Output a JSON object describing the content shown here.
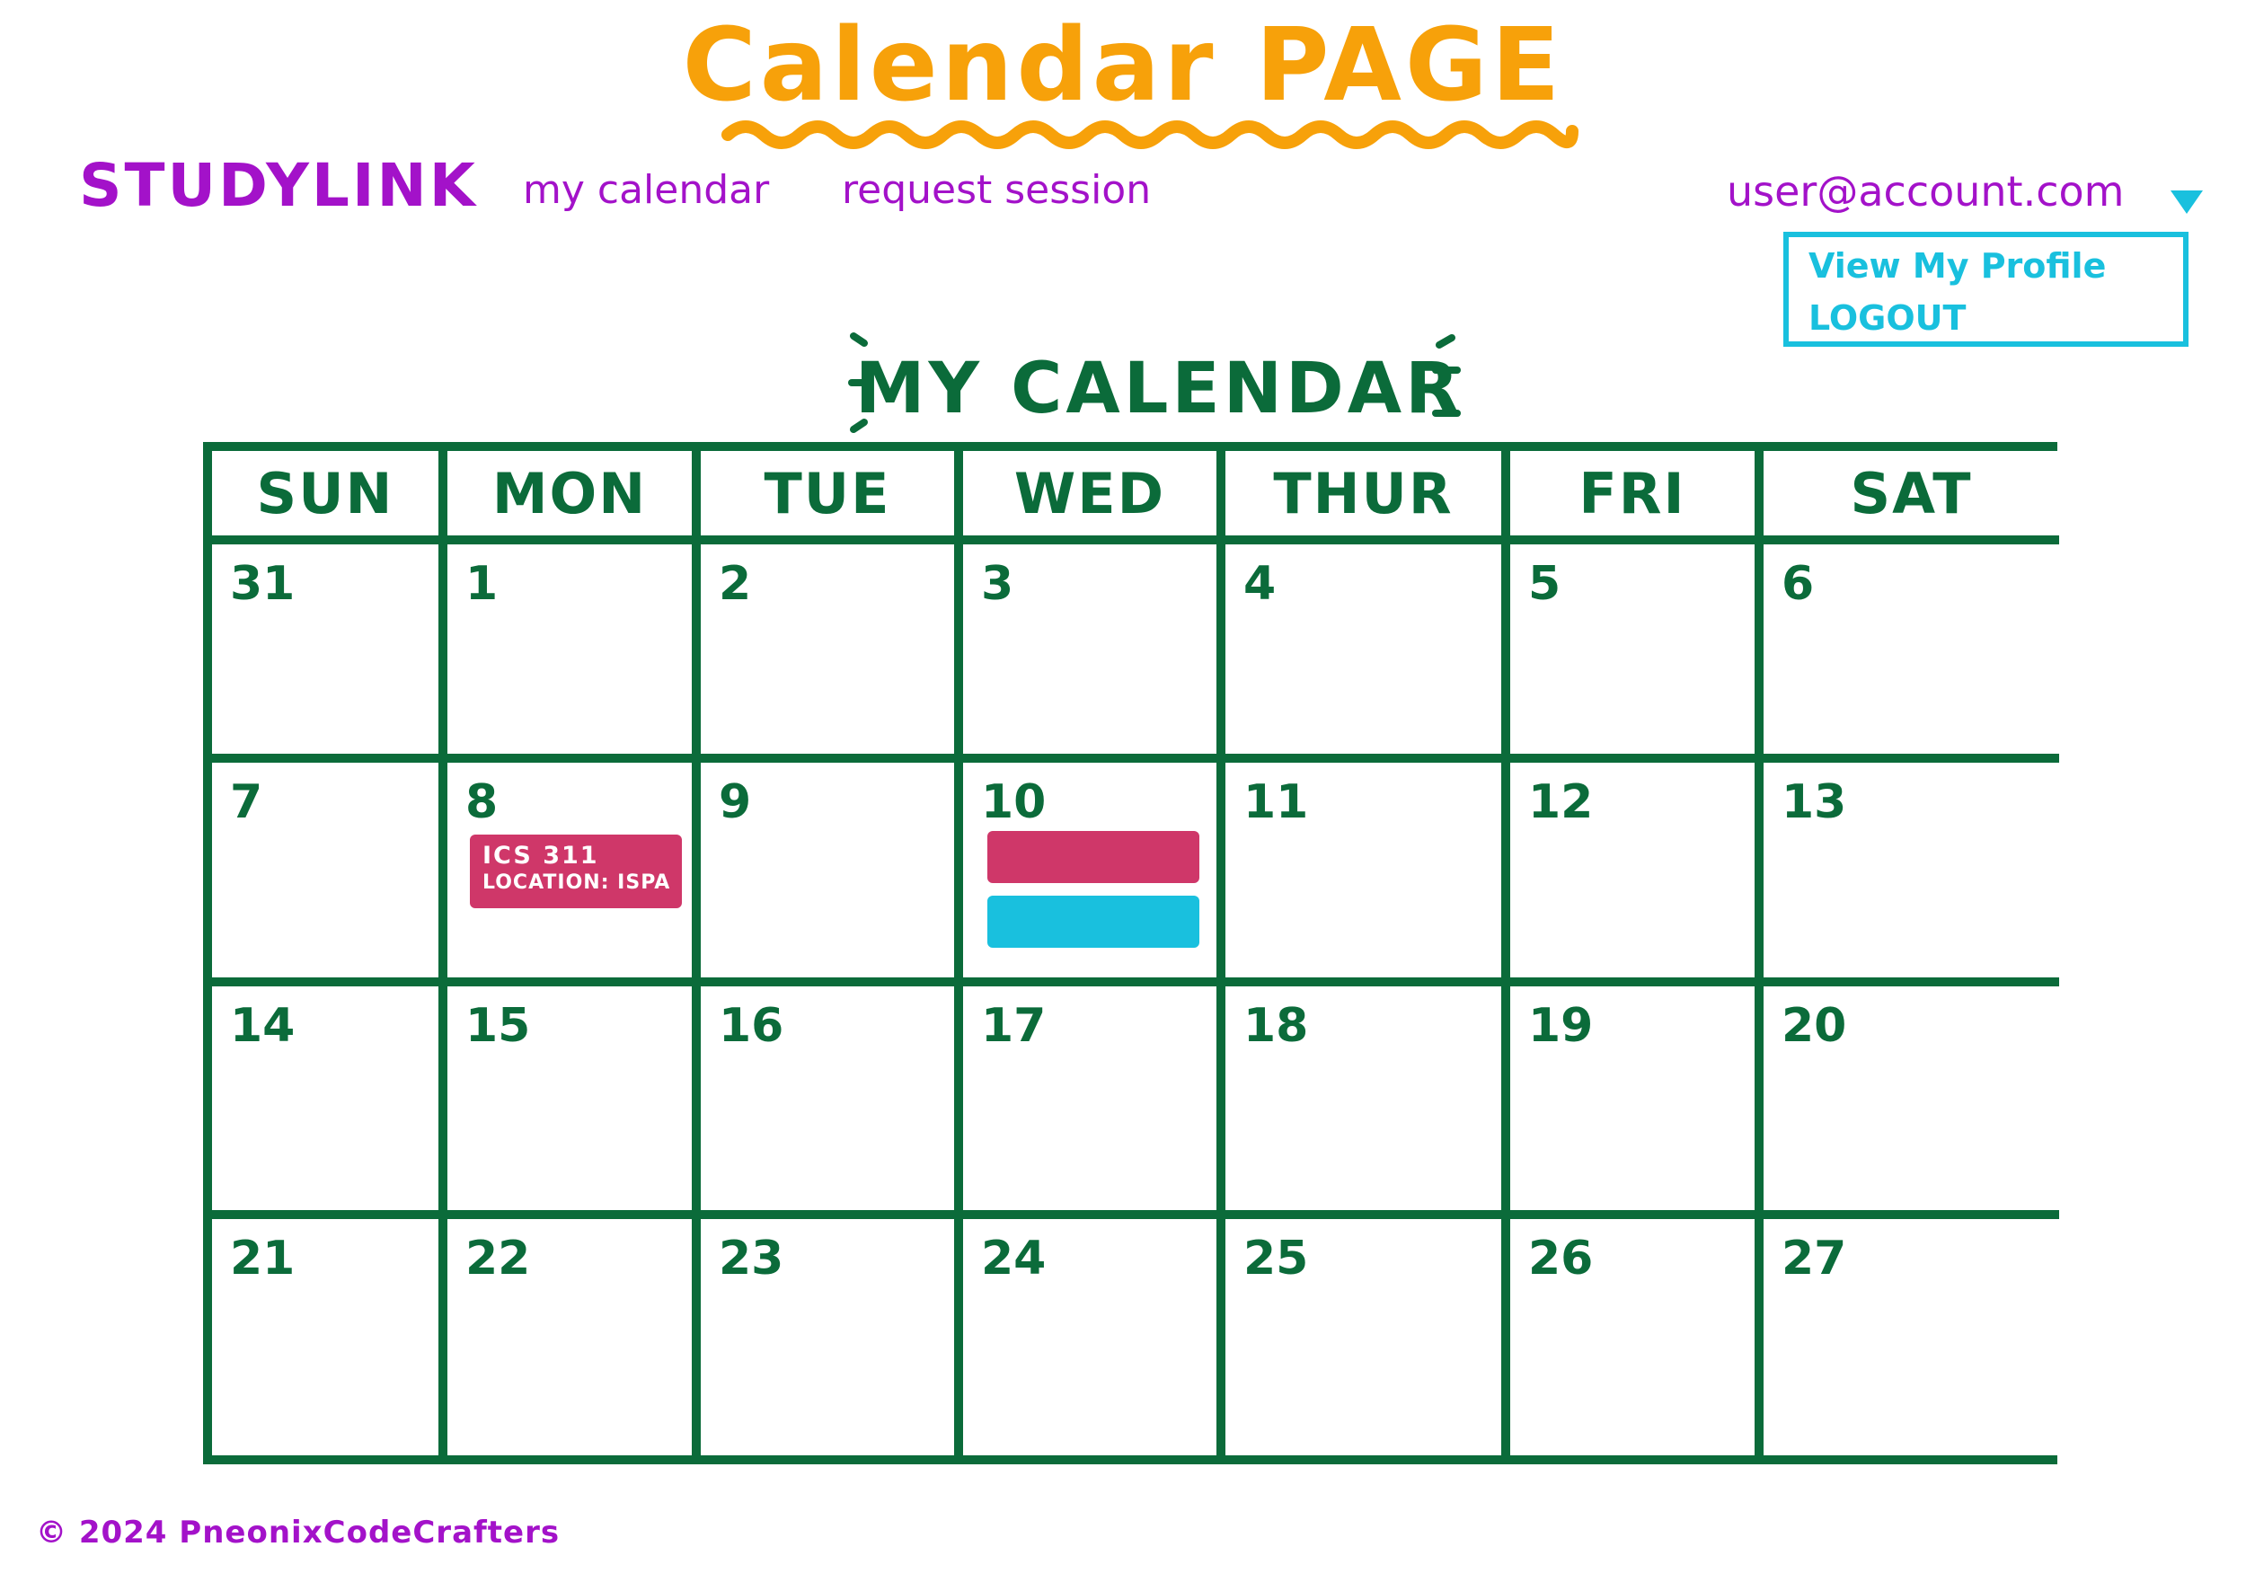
{
  "page_title": "Calendar PAGE",
  "header": {
    "brand": "STUDYLINK",
    "nav": {
      "my_calendar": "my calendar",
      "request_session": "request session"
    },
    "account": {
      "email": "user@account.com",
      "dropdown": {
        "view_profile": "View My Profile",
        "logout": "LOGOUT"
      }
    }
  },
  "calendar": {
    "heading": "MY CALENDAR",
    "days_of_week": [
      "SUN",
      "MON",
      "TUE",
      "WED",
      "THUR",
      "FRI",
      "SAT"
    ],
    "weeks": [
      [
        "31",
        "1",
        "2",
        "3",
        "4",
        "5",
        "6"
      ],
      [
        "7",
        "8",
        "9",
        "10",
        "11",
        "12",
        "13"
      ],
      [
        "14",
        "15",
        "16",
        "17",
        "18",
        "19",
        "20"
      ],
      [
        "21",
        "22",
        "23",
        "24",
        "25",
        "26",
        "27"
      ]
    ],
    "events": {
      "ics311": {
        "title": "ICS 311",
        "location": "LOCATION: ISPA",
        "color": "#CF3769"
      },
      "wed_event_1_color": "#CF3769",
      "wed_event_2_color": "#19C0DE"
    }
  },
  "footer": {
    "copyright": "© 2024 PneonixCodeCrafters"
  },
  "colors": {
    "title_orange": "#F7A10A",
    "brand_purple": "#A312C9",
    "calendar_green": "#0B6B3A",
    "accent_cyan": "#19C0DE",
    "event_pink": "#CF3769"
  },
  "icons": {
    "account_caret": "caret-down-icon",
    "title_underline": "wavy-underline-icon"
  }
}
